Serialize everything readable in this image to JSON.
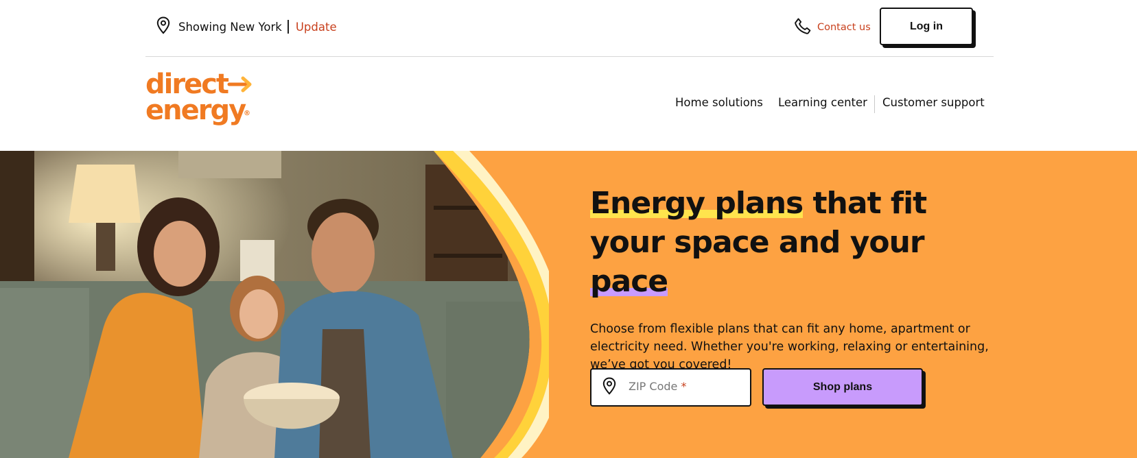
{
  "utility_bar": {
    "location_text": "Showing New York",
    "update_label": "Update",
    "contact_label": "Contact us",
    "login_label": "Log in",
    "location_icon": "map-pin-icon",
    "phone_icon": "phone-icon"
  },
  "brand": {
    "logo_line1": "direct",
    "logo_line2": "energy",
    "logo_mark": "®",
    "logo_color": "#f07a22"
  },
  "main_nav": {
    "items": [
      {
        "label": "Home solutions"
      },
      {
        "label": "Learning center"
      },
      {
        "label": "Customer support"
      }
    ]
  },
  "hero": {
    "title_part1": "Energy plans",
    "title_part2": " that fit your space and your ",
    "title_part3": "pace",
    "description": "Choose from flexible plans that can fit any home, apartment or electricity need. Whether you're working, relaxing or entertaining, we’ve got you covered!",
    "zip_placeholder": "ZIP Code",
    "zip_required_mark": "*",
    "zip_value": "",
    "shop_label": "Shop plans",
    "photo_description": "family-on-couch-eating-popcorn",
    "colors": {
      "background": "#fda242",
      "highlight_yellow": "#ffe44d",
      "highlight_purple": "#c89bff",
      "button_purple": "#c89bfc",
      "link_red": "#c8401d"
    }
  }
}
